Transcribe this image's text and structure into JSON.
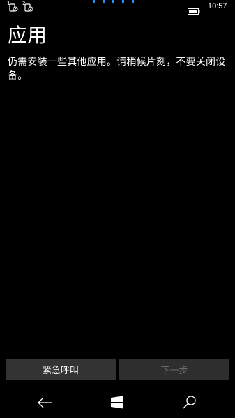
{
  "statusbar": {
    "sim1_number": "1",
    "sim2_number": "2",
    "time": "10:57",
    "battery_icon": "battery-icon",
    "accent": "#1e90ff"
  },
  "main": {
    "title": "应用",
    "description": "仍需安装一些其他应用。请稍候片刻，不要关闭设备。"
  },
  "buttons": {
    "emergency_label": "紧急呼叫",
    "next_label": "下一步"
  },
  "navbar": {
    "back_icon": "back-arrow-icon",
    "start_icon": "windows-logo-icon",
    "search_icon": "search-icon"
  }
}
